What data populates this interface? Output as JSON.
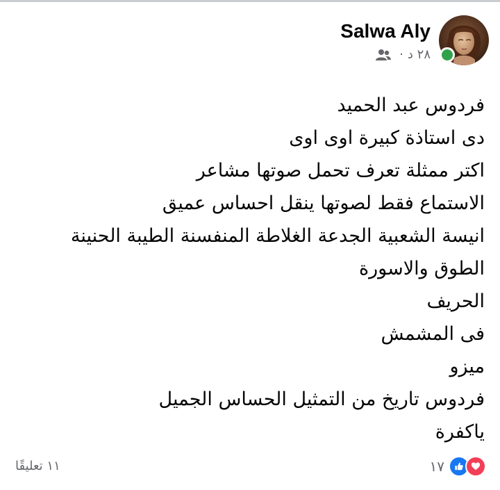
{
  "post": {
    "author": "Salwa Aly",
    "timestamp": "٢٨ د",
    "separator": "·",
    "audience_icon": "friends-icon",
    "online_status_color": "#31a24c",
    "lines": [
      "فردوس عبد الحميد",
      "دى استاذة كبيرة اوى اوى",
      "اكتر ممثلة تعرف تحمل صوتها مشاعر",
      "الاستماع فقط لصوتها ينقل احساس عميق",
      "انيسة الشعبية الجدعة الغلاطة المنفسنة الطيبة الحنينة",
      "الطوق والاسورة",
      "الحريف",
      "فى المشمش",
      "ميزو",
      "فردوس تاريخ من التمثيل الحساس الجميل",
      "ياكفرة"
    ],
    "reactions": {
      "icons": [
        "love-icon",
        "like-icon"
      ],
      "count": "١٧"
    },
    "comments_label": "١١ تعليقًا"
  },
  "colors": {
    "like": "#1877f2",
    "love": "#f33e58",
    "secondary_text": "#65676b"
  }
}
